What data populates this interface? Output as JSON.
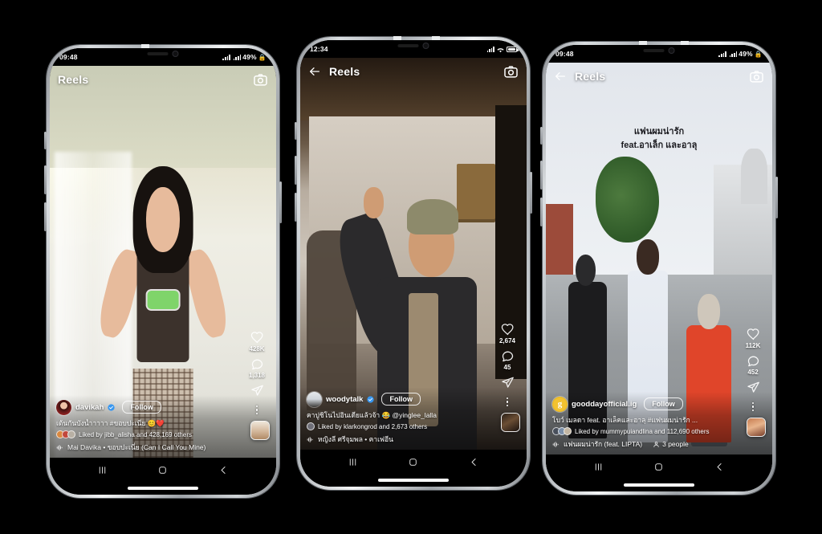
{
  "page": {
    "background_color": "#000000",
    "device_count": 3
  },
  "icons": {
    "back": "back-arrow-icon",
    "camera": "camera-icon",
    "heart": "heart-icon",
    "comment": "comment-icon",
    "share": "share-icon",
    "more": "more-options-icon",
    "verified": "verified-badge-icon",
    "audio": "audio-note-icon",
    "people": "people-icon",
    "nav_recents": "recents-icon",
    "nav_home": "home-icon",
    "nav_back": "back-chevron-icon",
    "wifi": "wifi-icon",
    "signal": "signal-bars-icon",
    "battery": "battery-icon",
    "lock": "lock-icon"
  },
  "phones": [
    {
      "id": "phone-1",
      "status_bar": {
        "time": "09:48",
        "battery_percent": "49%",
        "has_wifi": false,
        "has_lock": true,
        "show_battery_pct": true
      },
      "header": {
        "title": "Reels",
        "has_back": false,
        "camera_label": "Camera"
      },
      "actions": {
        "like_count": "428K",
        "comment_count": "1,318",
        "share_label": "Share",
        "more_label": "More"
      },
      "post": {
        "username": "davikah",
        "verified": true,
        "follow_label": "Follow",
        "caption": "เต้นกันบังน้ำาาาา #ขอบปะเนี่ย 😊❤️",
        "liked_by": "Liked by jibb_alisha and 428,169 others",
        "liked_by_user": "jibb_alisha",
        "audio": "Mai Davika • ขอบปะเนี่ย (Can I Call You Mine)",
        "people_tag": ""
      },
      "sticker": null
    },
    {
      "id": "phone-2",
      "status_bar": {
        "time": "12:34",
        "battery_percent": "",
        "has_wifi": true,
        "has_lock": false,
        "show_battery_pct": false
      },
      "header": {
        "title": "Reels",
        "has_back": true,
        "camera_label": "Camera"
      },
      "actions": {
        "like_count": "2,674",
        "comment_count": "45",
        "share_label": "Share",
        "more_label": "More"
      },
      "post": {
        "username": "woodytalk",
        "verified": true,
        "follow_label": "Follow",
        "caption": "คาปูชิโนไปอินเดียแล้วจ้า 😂 @yinglee_lalla",
        "liked_by": "Liked by klarkongrod and 2,673 others",
        "liked_by_user": "klarkongrod",
        "audio": "หญิงลี ศรีจุมพล • คาเฟอีน",
        "people_tag": ""
      },
      "sticker": null
    },
    {
      "id": "phone-3",
      "status_bar": {
        "time": "09:48",
        "battery_percent": "49%",
        "has_wifi": false,
        "has_lock": true,
        "show_battery_pct": true
      },
      "header": {
        "title": "Reels",
        "has_back": true,
        "camera_label": "Camera"
      },
      "actions": {
        "like_count": "112K",
        "comment_count": "452",
        "share_label": "Share",
        "more_label": "More"
      },
      "post": {
        "username": "gooddayofficial.ig",
        "verified": false,
        "follow_label": "Follow",
        "caption": "โบว์ เมลดา feat. อาเล็คและอาลุ #แฟนผมน่ารัก ...",
        "liked_by": "Liked by mummypuiandlina and 112,690 others",
        "liked_by_user": "mummypuiandlina",
        "audio": "แฟนผมน่ารัก (feat. LIPTA)",
        "people_tag": "3 people"
      },
      "sticker": {
        "line1": "แฟนผมน่ารัก",
        "line2": "feat.อาเล็ก และอาลุ"
      }
    }
  ]
}
